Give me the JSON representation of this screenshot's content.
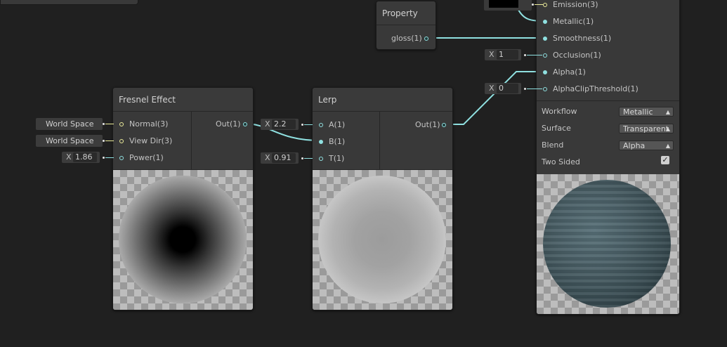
{
  "fresnel": {
    "title": "Fresnel Effect",
    "inputs": [
      "Normal(3)",
      "View Dir(3)",
      "Power(1)"
    ],
    "output": "Out(1)",
    "normal_space": "World Space",
    "viewdir_space": "World Space",
    "power_x": "X",
    "power_value": "1.86"
  },
  "lerp": {
    "title": "Lerp",
    "inputs": [
      "A(1)",
      "B(1)",
      "T(1)"
    ],
    "output": "Out(1)",
    "a_x": "X",
    "a_value": "2.2",
    "t_x": "X",
    "t_value": "0.91"
  },
  "property": {
    "title": "Property",
    "output": "gloss(1)"
  },
  "master": {
    "inputs": [
      "Emission(3)",
      "Metallic(1)",
      "Smoothness(1)",
      "Occlusion(1)",
      "Alpha(1)",
      "AlphaClipThreshold(1)"
    ],
    "occlusion_x": "X",
    "occlusion_value": "1",
    "clip_x": "X",
    "clip_value": "0",
    "settings": [
      {
        "label": "Workflow",
        "value": "Metallic"
      },
      {
        "label": "Surface",
        "value": "Transparent"
      },
      {
        "label": "Blend",
        "value": "Alpha"
      }
    ],
    "two_sided_label": "Two Sided",
    "two_sided_checked": "✓"
  },
  "colors": {
    "background": "#202020",
    "node": "#393939",
    "wire": "#8fe0e0",
    "vector_port": "#ecec9a"
  }
}
